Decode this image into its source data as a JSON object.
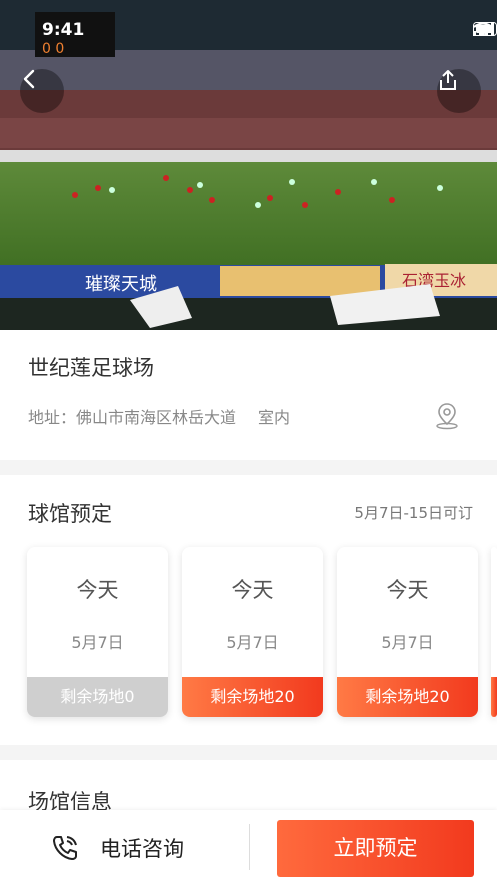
{
  "status_bar": {
    "time": "9:41"
  },
  "hero": {
    "scoreboard": "0      0",
    "banner_text": "璀璨天城",
    "banner_text_2": "石湾玉冰"
  },
  "venue": {
    "name": "世纪莲足球场",
    "address": "地址：佛山市南海区林岳大道",
    "type": "室内"
  },
  "booking": {
    "title": "球馆预定",
    "availability": "5月7日-15日可订",
    "days": [
      {
        "day": "今天",
        "date": "5月7日",
        "remaining": "剩余场地0",
        "status": "full"
      },
      {
        "day": "今天",
        "date": "5月7日",
        "remaining": "剩余场地20",
        "status": "available"
      },
      {
        "day": "今天",
        "date": "5月7日",
        "remaining": "剩余场地20",
        "status": "available"
      }
    ]
  },
  "venue_info": {
    "title": "场馆信息"
  },
  "bottom_bar": {
    "phone_label": "电话咨询",
    "book_label": "立即预定"
  },
  "colors": {
    "accent": "#f23a1e",
    "accent_light": "#ff7a45",
    "disabled": "#cfcfcf"
  }
}
